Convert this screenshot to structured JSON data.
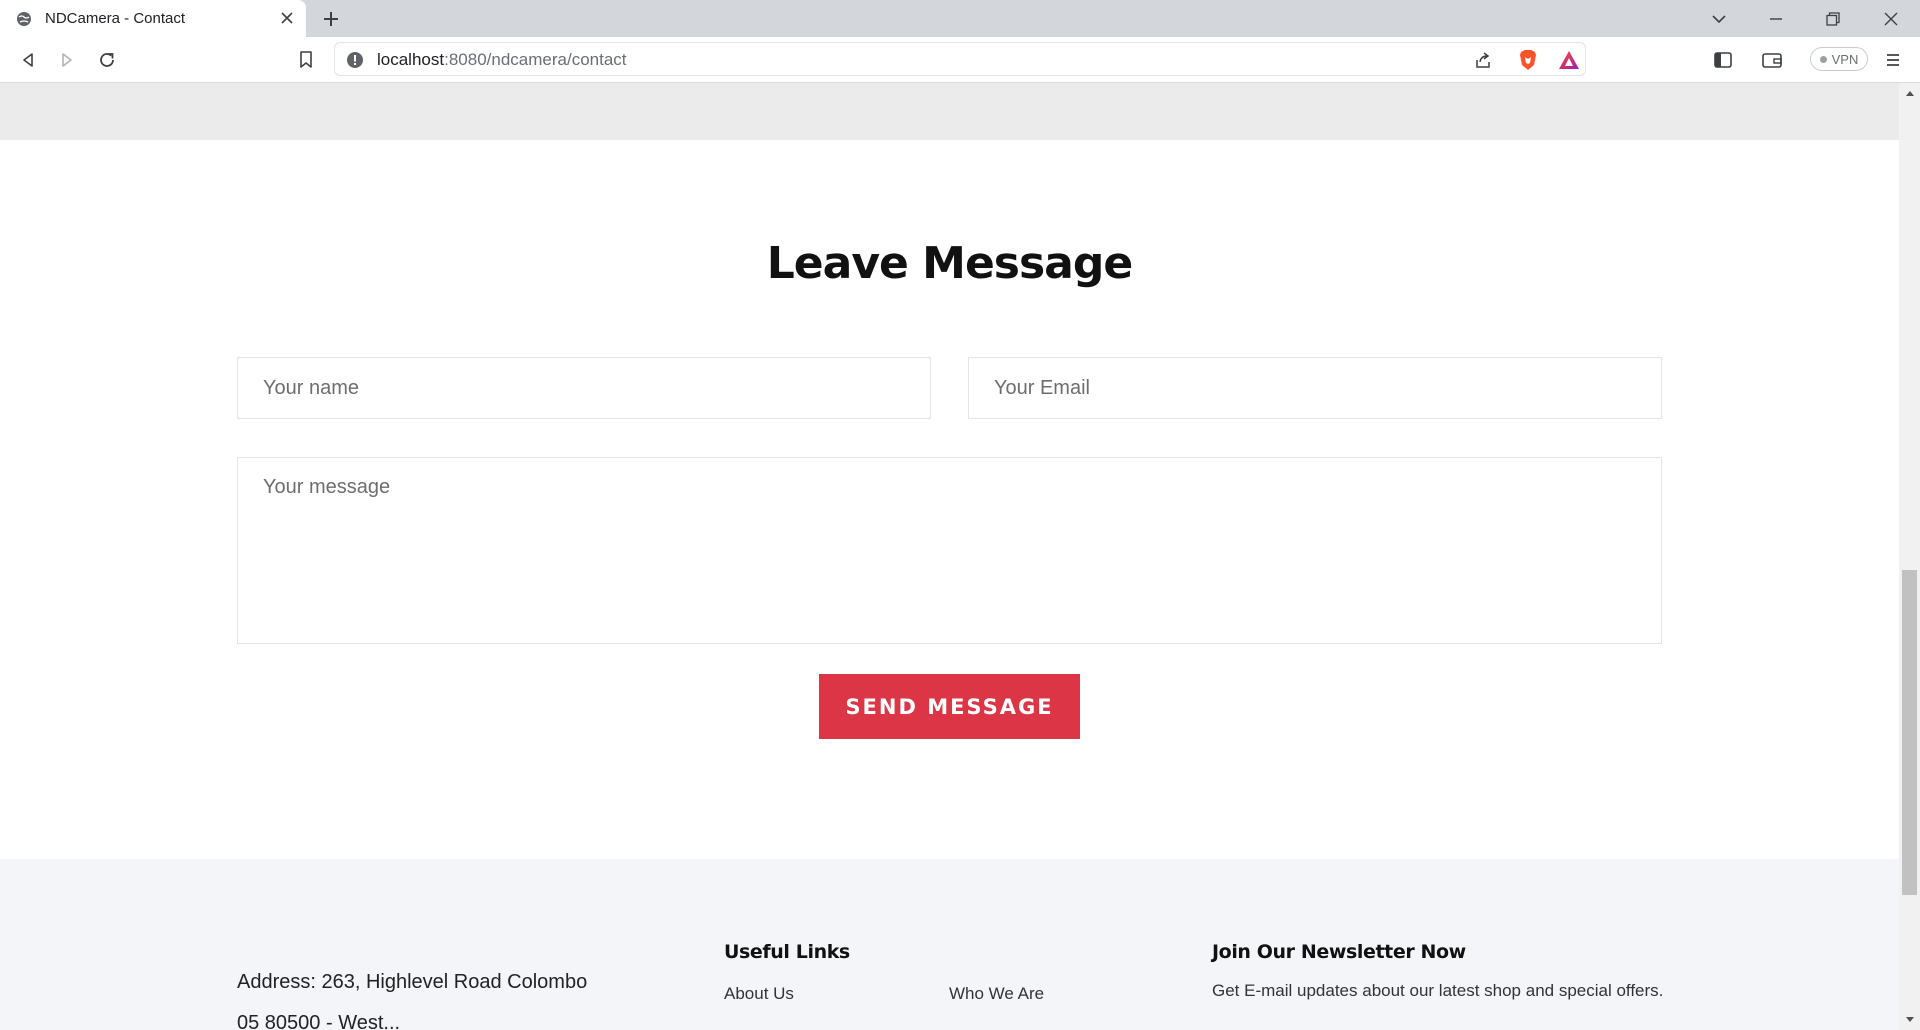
{
  "browser": {
    "tab_title": "NDCamera - Contact",
    "new_tab_icon": "plus-icon",
    "url_host": "localhost",
    "url_rest": ":8080/ndcamera/contact",
    "vpn_label": "VPN",
    "brand_colors": {
      "brave": "#fb542b",
      "rewards": "#9e1fbe",
      "accent": "#dc3545"
    }
  },
  "page": {
    "heading": "Leave Message",
    "form": {
      "name_placeholder": "Your name",
      "email_placeholder": "Your Email",
      "message_placeholder": "Your message",
      "submit_label": "SEND MESSAGE"
    }
  },
  "footer": {
    "address": "Address: 263, Highlevel Road Colombo",
    "address_line2": "05 80500 - West...",
    "useful_links_title": "Useful Links",
    "links": [
      "About Us",
      "Who We Are"
    ],
    "newsletter_title": "Join Our Newsletter Now",
    "newsletter_text": "Get E-mail updates about our latest shop and special offers."
  }
}
